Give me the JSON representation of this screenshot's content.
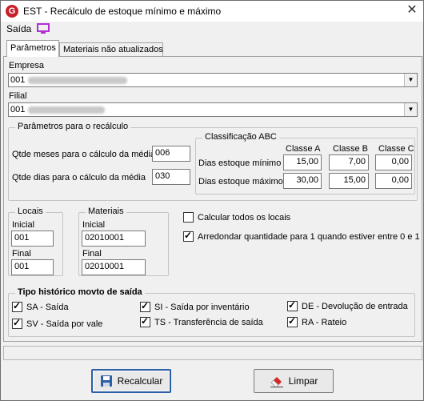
{
  "window": {
    "title": "EST - Recálculo de estoque mínimo e máximo",
    "logo_letter": "G",
    "close_glyph": "✕"
  },
  "menu": {
    "saida_label": "Saída"
  },
  "tabs": [
    "Parâmetros",
    "Materiais não atualizados"
  ],
  "empresa": {
    "label": "Empresa",
    "value": "001"
  },
  "filial": {
    "label": "Filial",
    "value": "001"
  },
  "recalculo": {
    "title": "Parâmetros para o recálculo",
    "meses_label": "Qtde meses para o cálculo da média",
    "meses_value": "006",
    "dias_label": "Qtde dias para o cálculo da média",
    "dias_value": "030"
  },
  "abc": {
    "title": "Classificação ABC",
    "columns": [
      "Classe A",
      "Classe B",
      "Classe C"
    ],
    "row_min_label": "Dias estoque mínimo",
    "row_max_label": "Dias estoque máximo",
    "min": [
      "15,00",
      "7,00",
      "0,00"
    ],
    "max": [
      "30,00",
      "15,00",
      "0,00"
    ]
  },
  "locais": {
    "title": "Locais",
    "inicial_label": "Inicial",
    "inicial_value": "001",
    "final_label": "Final",
    "final_value": "001"
  },
  "materiais": {
    "title": "Materiais",
    "inicial_label": "Inicial",
    "inicial_value": "02010001",
    "final_label": "Final",
    "final_value": "02010001"
  },
  "options": {
    "calcular_todos": {
      "label": "Calcular todos os locais",
      "checked": false
    },
    "arredondar": {
      "label": "Arredondar quantidade para 1 quando estiver entre 0 e 1",
      "checked": true
    }
  },
  "historico": {
    "title": "Tipo histórico movto de saída",
    "items": [
      {
        "label": "SA - Saída",
        "checked": true
      },
      {
        "label": "SV - Saída por vale",
        "checked": true
      },
      {
        "label": "SI - Saída por inventário",
        "checked": true
      },
      {
        "label": "TS - Transferência de saída",
        "checked": true
      },
      {
        "label": "DE - Devolução de entrada",
        "checked": true
      },
      {
        "label": "RA - Rateio",
        "checked": true
      }
    ]
  },
  "buttons": {
    "recalcular": "Recalcular",
    "limpar": "Limpar"
  },
  "colors": {
    "accent": "#2b5fa6",
    "logo": "#c8202a",
    "monitor_icon": "#b02fd0"
  }
}
